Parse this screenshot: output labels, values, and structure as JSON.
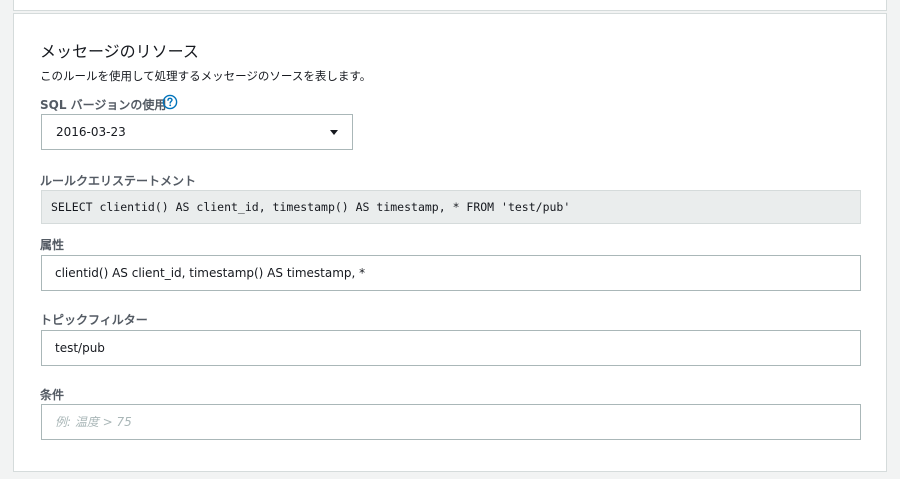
{
  "section": {
    "title": "メッセージのリソース",
    "description": "このルールを使用して処理するメッセージのソースを表します。"
  },
  "sql_version": {
    "label": "SQL バージョンの使用",
    "help_icon": "question-circle-icon",
    "selected": "2016-03-23"
  },
  "rule_statement": {
    "label": "ルールクエリステートメント",
    "value": "SELECT clientid() AS client_id, timestamp() AS timestamp, * FROM 'test/pub'"
  },
  "attribute": {
    "label": "属性",
    "value": "clientid() AS client_id, timestamp() AS timestamp, *"
  },
  "topic_filter": {
    "label": "トピックフィルター",
    "value": "test/pub"
  },
  "condition": {
    "label": "条件",
    "value": "",
    "placeholder": "例: 温度 > 75"
  },
  "colors": {
    "accent": "#0073bb",
    "background": "#f2f3f3",
    "border": "#aab7b8"
  }
}
